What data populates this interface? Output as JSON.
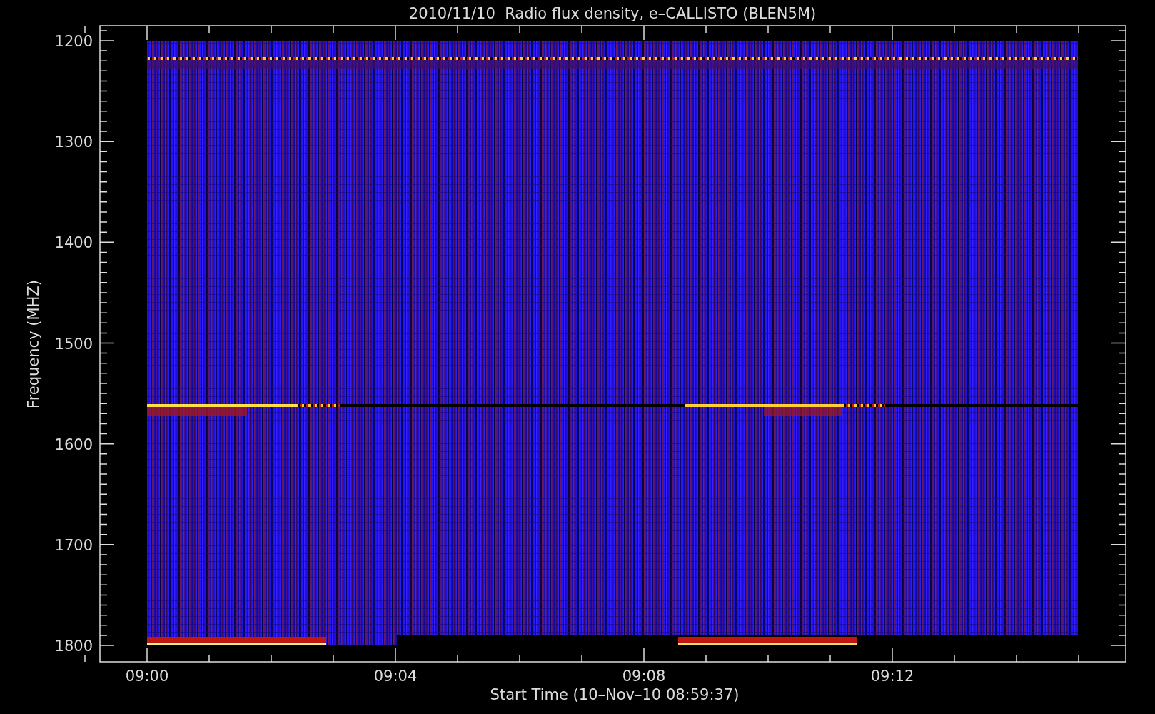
{
  "title": "2010/11/10  Radio flux density, e–CALLISTO (BLEN5M)",
  "y_axis": {
    "label": "Frequency (MHZ)",
    "ticks": [
      "1200",
      "1300",
      "1400",
      "1500",
      "1600",
      "1700",
      "1800"
    ]
  },
  "x_axis": {
    "label": "Start Time (10–Nov–10 08:59:37)",
    "ticks": [
      "09:00",
      "09:04",
      "09:08",
      "09:12"
    ]
  }
}
